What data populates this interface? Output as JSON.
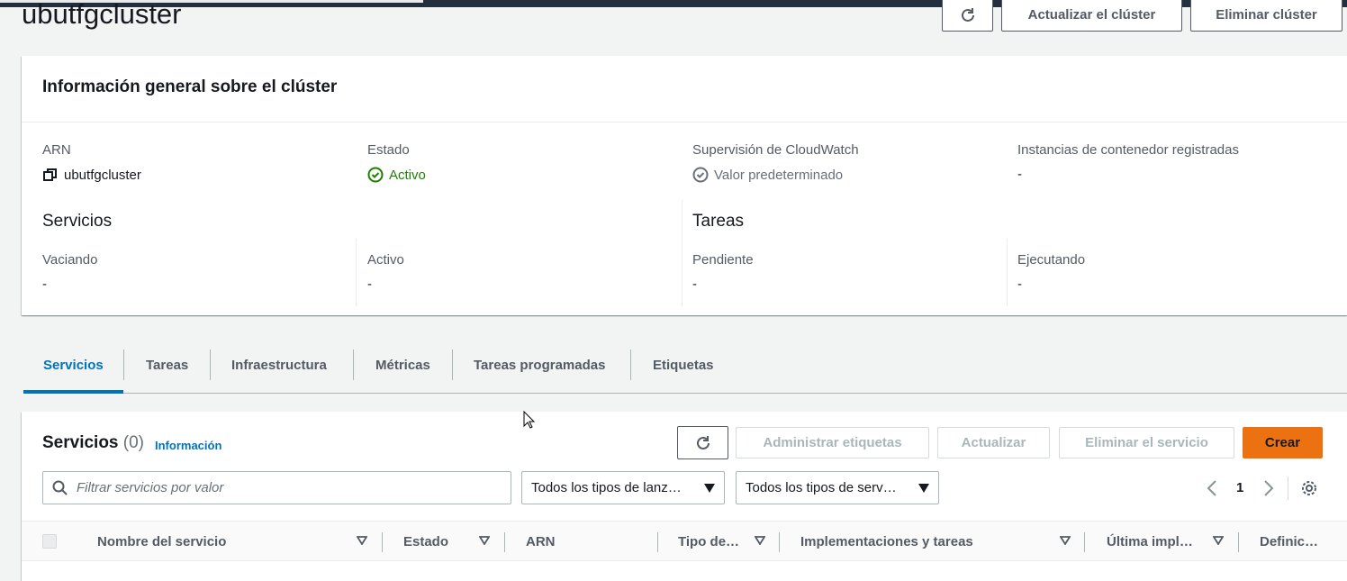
{
  "page": {
    "title": "ubutfgcluster"
  },
  "header_actions": {
    "refresh_icon": "refresh-icon",
    "update_cluster": "Actualizar el clúster",
    "delete_cluster": "Eliminar clúster"
  },
  "overview": {
    "title": "Información general sobre el clúster",
    "arn": {
      "label": "ARN",
      "value": "ubutfgcluster",
      "icon": "copy-icon"
    },
    "status": {
      "label": "Estado",
      "value": "Activo",
      "icon": "check-circle-icon",
      "color": "#1d8102"
    },
    "cloudwatch": {
      "label": "Supervisión de CloudWatch",
      "value": "Valor predeterminado",
      "icon": "check-circle-outline-icon"
    },
    "instances": {
      "label": "Instancias de contenedor registradas",
      "value": "-"
    },
    "services": {
      "title": "Servicios",
      "draining": {
        "label": "Vaciando",
        "value": "-"
      },
      "active": {
        "label": "Activo",
        "value": "-"
      }
    },
    "tasks": {
      "title": "Tareas",
      "pending": {
        "label": "Pendiente",
        "value": "-"
      },
      "running": {
        "label": "Ejecutando",
        "value": "-"
      }
    }
  },
  "tabs": [
    "Servicios",
    "Tareas",
    "Infraestructura",
    "Métricas",
    "Tareas programadas",
    "Etiquetas"
  ],
  "services_panel": {
    "title": "Servicios",
    "count": "(0)",
    "info": "Información",
    "buttons": {
      "manage_tags": "Administrar etiquetas",
      "update": "Actualizar",
      "delete_service": "Eliminar el servicio",
      "create": "Crear"
    },
    "search_placeholder": "Filtrar servicios por valor",
    "launch_type_select": "Todos los tipos de lanz…",
    "service_type_select": "Todos los tipos de serv…",
    "page": "1",
    "columns": [
      "Nombre del servicio",
      "Estado",
      "ARN",
      "Tipo de…",
      "Implementaciones y tareas",
      "Última impl…",
      "Definic…"
    ]
  },
  "colors": {
    "accent": "#0073bb",
    "primary_button": "#ec7211",
    "active_green": "#1d8102"
  }
}
